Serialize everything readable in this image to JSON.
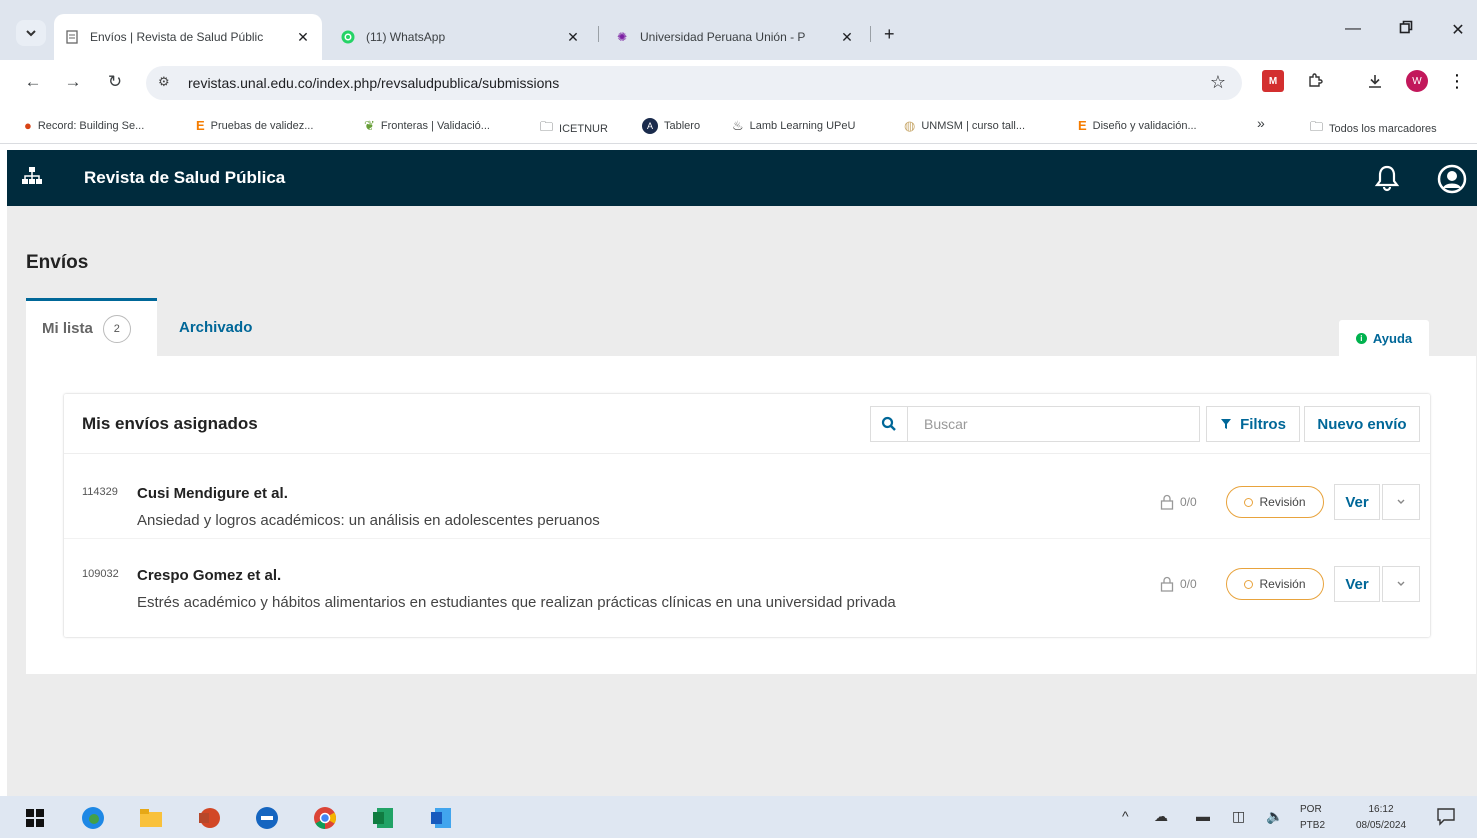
{
  "browser": {
    "tabs": [
      {
        "title": "Envíos | Revista de Salud Públic",
        "active": true
      },
      {
        "title": "(11) WhatsApp",
        "active": false
      },
      {
        "title": "Universidad Peruana Unión - P",
        "active": false
      }
    ],
    "url": "revistas.unal.edu.co/index.php/revsaludpublica/submissions",
    "bookmarks": [
      "Record: Building Se...",
      "Pruebas de validez...",
      "Fronteras | Validació...",
      "ICETNUR",
      "Tablero",
      "Lamb Learning UPeU",
      "UNMSM | curso tall...",
      "Diseño y validación..."
    ],
    "bookmarks_overflow": "»",
    "all_bookmarks": "Todos los marcadores",
    "profile_initial": "W"
  },
  "app": {
    "title": "Revista de Salud Pública"
  },
  "page": {
    "title": "Envíos",
    "tabs": {
      "my_list": "Mi lista",
      "my_list_count": "2",
      "archived": "Archivado"
    },
    "help": "Ayuda"
  },
  "panel": {
    "title": "Mis envíos asignados",
    "search_placeholder": "Buscar",
    "filters": "Filtros",
    "new_submission": "Nuevo envío",
    "submissions": [
      {
        "id": "114329",
        "authors": "Cusi Mendigure et al.",
        "title": "Ansiedad y logros académicos: un análisis en adolescentes peruanos",
        "tasks": "0/0",
        "stage": "Revisión",
        "view": "Ver"
      },
      {
        "id": "109032",
        "authors": "Crespo Gomez et al.",
        "title": "Estrés académico y hábitos alimentarios en estudiantes que realizan prácticas clínicas en una universidad privada",
        "tasks": "0/0",
        "stage": "Revisión",
        "view": "Ver"
      }
    ]
  },
  "taskbar": {
    "lang": "POR",
    "layout": "PTB2",
    "time": "16:12",
    "date": "08/05/2024"
  },
  "colors": {
    "header_bg": "#002b3d",
    "primary": "#006798",
    "stage_review": "#e8a33d",
    "help_icon": "#00b24e"
  }
}
